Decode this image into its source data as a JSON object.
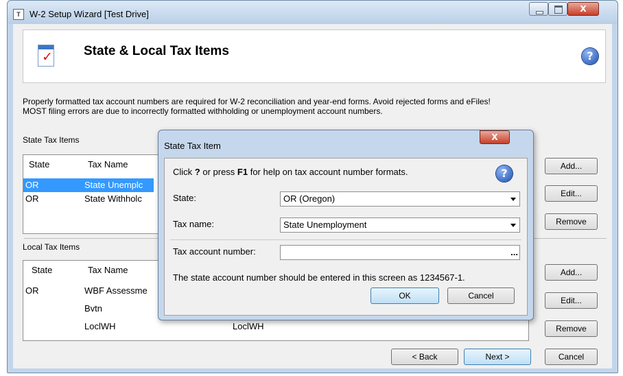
{
  "window": {
    "app_icon_letter": "T",
    "title": "W-2 Setup Wizard [Test Drive]",
    "minimize_icon": "minimize-icon",
    "maximize_icon": "maximize-icon",
    "close_glyph": "X"
  },
  "header": {
    "icon": "checklist-document-icon",
    "title": "State & Local Tax Items",
    "help_glyph": "?"
  },
  "intro": {
    "line1": "Properly formatted tax account numbers are required for W-2 reconciliation and year-end forms. Avoid rejected forms and eFiles!",
    "line2": "MOST filing errors are due to incorrectly formatted withholding or unemployment account numbers."
  },
  "state_section": {
    "label": "State Tax Items",
    "columns": [
      "State",
      "Tax Name"
    ],
    "rows": [
      {
        "state": "OR",
        "tax_name": "State Unemplc",
        "selected": true
      },
      {
        "state": "OR",
        "tax_name": "State Withholc",
        "selected": false
      }
    ],
    "buttons": {
      "add": "Add...",
      "edit": "Edit...",
      "remove": "Remove"
    }
  },
  "local_section": {
    "label": "Local Tax Items",
    "columns": [
      "State",
      "Tax Name"
    ],
    "rows": [
      {
        "state": "OR",
        "tax_name": "WBF Assessme",
        "extra": ""
      },
      {
        "state": "",
        "tax_name": "Bvtn",
        "extra": ""
      },
      {
        "state": "",
        "tax_name": "LoclWH",
        "extra": "LoclWH"
      }
    ],
    "buttons": {
      "add": "Add...",
      "edit": "Edit...",
      "remove": "Remove"
    }
  },
  "nav": {
    "back": "< Back",
    "next": "Next >",
    "cancel": "Cancel"
  },
  "dialog": {
    "title": "State Tax Item",
    "close_glyph": "X",
    "help_text_parts": [
      "Click ",
      "?",
      " or press ",
      "F1",
      " for help on tax account number formats."
    ],
    "help_glyph": "?",
    "state_label": "State:",
    "state_value": "OR (Oregon)",
    "tax_name_label": "Tax name:",
    "tax_name_value": "State Unemployment",
    "account_label": "Tax account number:",
    "account_value": "",
    "ellipsis": "...",
    "format_note": "The state account number should be entered in this screen as 1234567-1.",
    "ok": "OK",
    "cancel": "Cancel"
  },
  "colors": {
    "selection": "#3399ff",
    "window_frame": "#c2d5ea",
    "close_button": "#c6402a"
  }
}
